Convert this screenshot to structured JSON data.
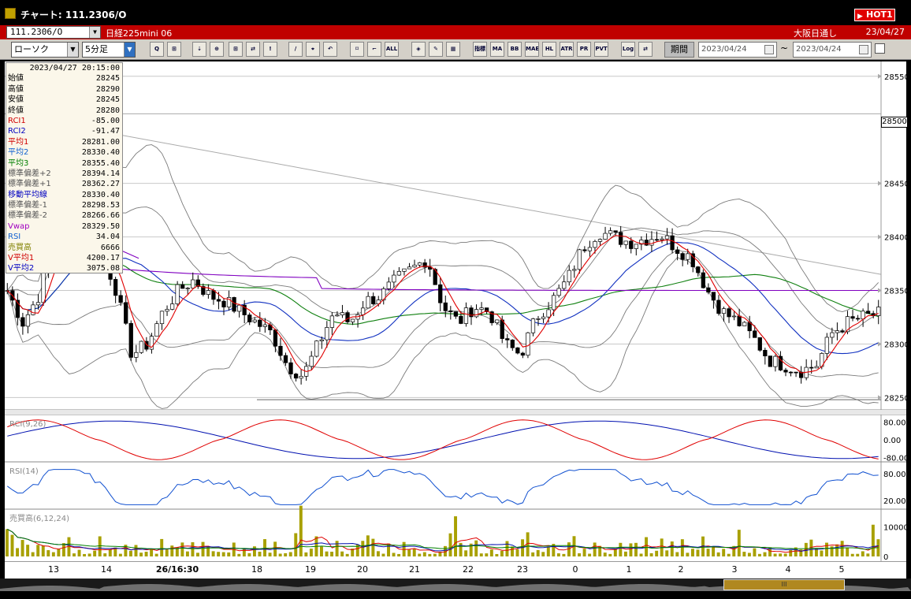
{
  "window": {
    "title": "チャート: 111.2306/O",
    "hot_label": "HOT1"
  },
  "infobar": {
    "symbol": "111.2306/O",
    "instrument": "日経225mini 06",
    "market": "大阪日通し",
    "date": "23/04/27"
  },
  "toolbar": {
    "chart_type": "ローソク",
    "timeframe": "5分足",
    "period_label": "期間",
    "date_from": "2023/04/24",
    "date_to": "2023/04/24",
    "tilde": "~",
    "buttons": [
      "Q",
      "⊞",
      "⇣",
      "⊕",
      "⊞",
      "⇄",
      "!",
      "∕",
      "⌖",
      "↶",
      "⌑",
      "⌐",
      "ALL",
      "◈",
      "✎",
      "▦",
      "指標",
      "MA",
      "BB",
      "MAE",
      "HL",
      "ATR",
      "PR",
      "PVT",
      "Log",
      "⇄"
    ]
  },
  "panel": {
    "datetime": "2023/04/27  20:15:00",
    "rows": [
      {
        "label": "始値",
        "value": "28245",
        "color": "#000000"
      },
      {
        "label": "高値",
        "value": "28290",
        "color": "#000000"
      },
      {
        "label": "安値",
        "value": "28245",
        "color": "#000000"
      },
      {
        "label": "終値",
        "value": "28280",
        "color": "#000000"
      },
      {
        "label": "RCI1",
        "value": "-85.00",
        "color": "#d00000"
      },
      {
        "label": "RCI2",
        "value": "-91.47",
        "color": "#0000c0"
      },
      {
        "label": "平均1",
        "value": "28281.00",
        "color": "#d00000"
      },
      {
        "label": "平均2",
        "value": "28330.40",
        "color": "#1060d0"
      },
      {
        "label": "平均3",
        "value": "28355.40",
        "color": "#008000"
      },
      {
        "label": "標準偏差+2",
        "value": "28394.14",
        "color": "#555555"
      },
      {
        "label": "標準偏差+1",
        "value": "28362.27",
        "color": "#555555"
      },
      {
        "label": "移動平均線",
        "value": "28330.40",
        "color": "#0000c0"
      },
      {
        "label": "標準偏差-1",
        "value": "28298.53",
        "color": "#555555"
      },
      {
        "label": "標準偏差-2",
        "value": "28266.66",
        "color": "#555555"
      },
      {
        "label": "Vwap",
        "value": "28329.50",
        "color": "#a000c0"
      },
      {
        "label": "RSI",
        "value": "34.04",
        "color": "#1060d0"
      },
      {
        "label": "売買高",
        "value": "6666",
        "color": "#808000"
      },
      {
        "label": "V平均1",
        "value": "4200.17",
        "color": "#d00000"
      },
      {
        "label": "V平均2",
        "value": "3075.08",
        "color": "#0000c0"
      }
    ]
  },
  "price_axis": {
    "labels": [
      "28550",
      "28500",
      "28450",
      "28400",
      "28350",
      "28300",
      "28250"
    ],
    "current": "28500"
  },
  "subpanels": {
    "rci": {
      "label": "RCI(9,26)",
      "axis": [
        "80.00",
        "0.00",
        "-80.00"
      ]
    },
    "rsi": {
      "label": "RSI(14)",
      "axis": [
        "80.00",
        "20.00"
      ]
    },
    "volume": {
      "label": "売買高(6,12,24)",
      "axis": [
        "10000",
        "0"
      ]
    }
  },
  "xaxis": {
    "labels": [
      "13",
      "14",
      "26/16:30",
      "18",
      "19",
      "20",
      "21",
      "22",
      "23",
      "0",
      "1",
      "2",
      "3",
      "4",
      "5"
    ]
  },
  "colors": {
    "up": "#ffffff",
    "down": "#000000",
    "ma_short": "#e00000",
    "ma_mid": "#1030c0",
    "ma_long": "#108010",
    "vwap": "#8000c0",
    "bands": "#777777",
    "volume": "#a8a000"
  },
  "chart_data": {
    "type": "candlestick",
    "price_range": [
      28240,
      28555
    ],
    "x": [
      "13",
      "14",
      "26/16:30",
      "18",
      "19",
      "20",
      "21",
      "22",
      "23",
      "0",
      "1",
      "2",
      "3",
      "4",
      "5"
    ],
    "close_series": [
      28350,
      28320,
      28345,
      28400,
      28435,
      28410,
      28390,
      28350,
      28290,
      28300,
      28330,
      28350,
      28360,
      28345,
      28340,
      28330,
      28320,
      28310,
      28280,
      28270,
      28300,
      28330,
      28320,
      28340,
      28345,
      28360,
      28370,
      28380,
      28335,
      28320,
      28335,
      28330,
      28300,
      28290,
      28325,
      28340,
      28360,
      28390,
      28405,
      28400,
      28395,
      28398,
      28402,
      28390,
      28380,
      28350,
      28330,
      28320,
      28305,
      28285,
      28280,
      28275,
      28280,
      28310,
      28320,
      28325,
      28328
    ],
    "current_price": 28500
  }
}
